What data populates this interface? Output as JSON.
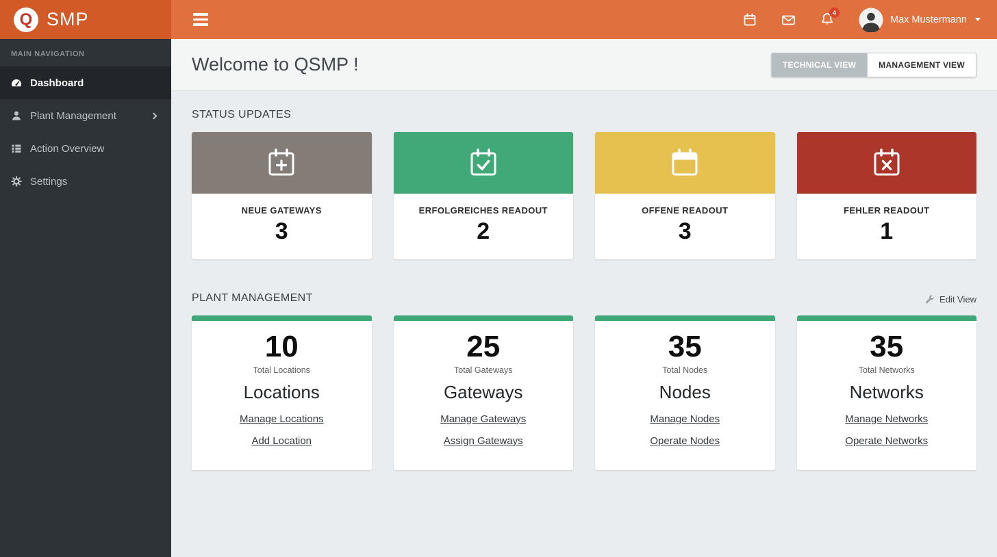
{
  "topbar": {
    "logo_q": "Q",
    "logo_text": "SMP",
    "notification_count": "4",
    "user_name": "Max Mustermann"
  },
  "sidebar": {
    "section_label": "MAIN NAVIGATION",
    "items": [
      {
        "label": "Dashboard",
        "active": true
      },
      {
        "label": "Plant Management",
        "has_submenu": true
      },
      {
        "label": "Action Overview"
      },
      {
        "label": "Settings"
      }
    ]
  },
  "header": {
    "title": "Welcome to QSMP !",
    "technical_view_label": "TECHNICAL VIEW",
    "management_view_label": "MANAGEMENT VIEW"
  },
  "status_section": {
    "title": "STATUS UPDATES",
    "cards": [
      {
        "label": "NEUE GATEWAYS",
        "value": "3",
        "color": "#847d77",
        "icon": "calendar-plus-icon"
      },
      {
        "label": "ERFOLGREICHES READOUT",
        "value": "2",
        "color": "#41a877",
        "icon": "calendar-check-icon"
      },
      {
        "label": "OFFENE READOUT",
        "value": "3",
        "color": "#e6c150",
        "icon": "calendar-icon"
      },
      {
        "label": "FEHLER READOUT",
        "value": "1",
        "color": "#ab3629",
        "icon": "calendar-x-icon"
      }
    ]
  },
  "plant_section": {
    "title": "PLANT MANAGEMENT",
    "edit_view_label": "Edit View",
    "strip_color": "#41a877",
    "cards": [
      {
        "value": "10",
        "subtitle": "Total Locations",
        "title": "Locations",
        "links": [
          "Manage Locations",
          "Add Location"
        ]
      },
      {
        "value": "25",
        "subtitle": "Total Gateways",
        "title": "Gateways",
        "links": [
          "Manage Gateways",
          "Assign Gateways"
        ]
      },
      {
        "value": "35",
        "subtitle": "Total Nodes",
        "title": "Nodes",
        "links": [
          "Manage Nodes",
          "Operate Nodes"
        ]
      },
      {
        "value": "35",
        "subtitle": "Total Networks",
        "title": "Networks",
        "links": [
          "Manage Networks",
          "Operate Networks"
        ]
      }
    ]
  }
}
